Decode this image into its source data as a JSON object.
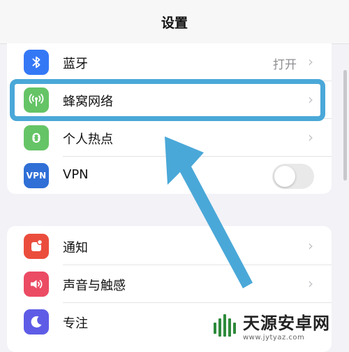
{
  "nav": {
    "title": "设置"
  },
  "group1": {
    "rows": [
      {
        "label": "蓝牙",
        "value": "打开",
        "icon": "bluetooth-icon",
        "color": "#3478f6"
      },
      {
        "label": "蜂窝网络",
        "icon": "cellular-antenna-icon",
        "color": "#65c466"
      },
      {
        "label": "个人热点",
        "icon": "personal-hotspot-icon",
        "color": "#65c466"
      },
      {
        "label": "VPN",
        "icon_text": "VPN",
        "icon": "vpn-icon",
        "color": "#2f6fd6",
        "toggle_on": false
      }
    ]
  },
  "group2": {
    "rows": [
      {
        "label": "通知",
        "icon": "notifications-icon",
        "color": "#eb4d3d"
      },
      {
        "label": "声音与触感",
        "icon": "sound-speaker-icon",
        "color": "#eb4b63"
      },
      {
        "label": "专注",
        "icon": "moon-icon",
        "color": "#5e5ce6"
      }
    ]
  },
  "annotation": {
    "highlight_color": "#4aa8d8"
  },
  "watermark": {
    "name": "天源安卓网",
    "url": "www.jytyaz.com"
  }
}
